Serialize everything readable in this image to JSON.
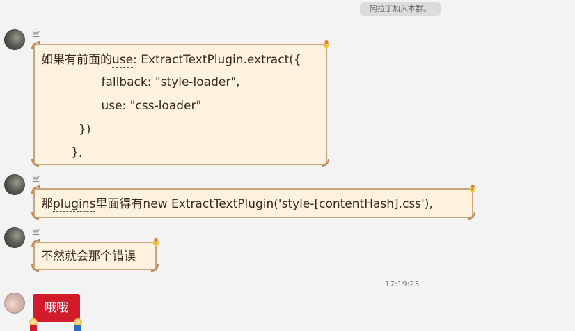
{
  "system_notice": "阿拉丁加入本群。",
  "messages": [
    {
      "sender": "空",
      "lines": [
        [
          "如果有前面的",
          "use",
          ": ExtractTextPlugin.extract({"
        ],
        [
          "                fallback: \"style-loader\","
        ],
        [
          "                use: \"css-loader\""
        ],
        [
          "          })"
        ],
        [
          "        },"
        ]
      ]
    },
    {
      "sender": "空",
      "lines": [
        [
          "那",
          "plugins",
          "里面得有new ExtractTextPlugin('style-[contentHash].css'),"
        ]
      ]
    },
    {
      "sender": "空",
      "lines": [
        [
          "不然就会那个错误"
        ]
      ]
    }
  ],
  "timestamp": "17:19:23",
  "my_message": "哦哦",
  "colors": {
    "bubble_bg": "#fff3df",
    "bubble_border": "#c9a47c",
    "my_bubble_bg": "#d11b2a"
  }
}
